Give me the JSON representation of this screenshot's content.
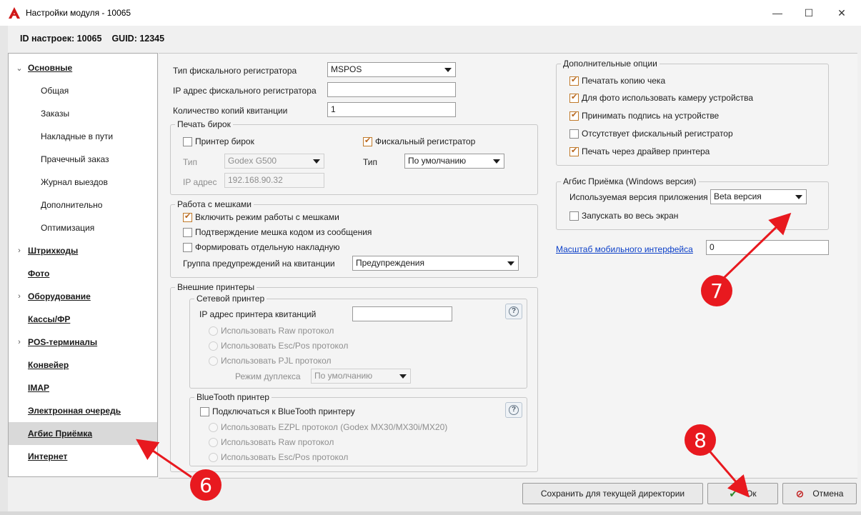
{
  "window": {
    "title": "Настройки модуля - 10065",
    "minimize": "—",
    "maximize": "☐",
    "close": "✕"
  },
  "ids": {
    "settings_id": "ID настроек: 10065",
    "guid": "GUID: 12345"
  },
  "nav": {
    "items": [
      {
        "label": "Основные",
        "caret": "⌄",
        "level": 1
      },
      {
        "label": "Общая",
        "level": 2
      },
      {
        "label": "Заказы",
        "level": 2
      },
      {
        "label": "Накладные в пути",
        "level": 2
      },
      {
        "label": "Прачечный заказ",
        "level": 2
      },
      {
        "label": "Журнал выездов",
        "level": 2
      },
      {
        "label": "Дополнительно",
        "level": 2
      },
      {
        "label": "Оптимизация",
        "level": 2
      },
      {
        "label": "Штрихкоды",
        "caret": "›",
        "level": 1
      },
      {
        "label": "Фото",
        "level": 1
      },
      {
        "label": "Оборудование",
        "caret": "›",
        "level": 1
      },
      {
        "label": "Кассы/ФР",
        "level": 1
      },
      {
        "label": "POS-терминалы",
        "caret": "›",
        "level": 1
      },
      {
        "label": "Конвейер",
        "level": 1
      },
      {
        "label": "IMAP",
        "level": 1
      },
      {
        "label": "Электронная очередь",
        "level": 1
      },
      {
        "label": "Агбис Приёмка",
        "level": 1,
        "selected": true
      },
      {
        "label": "Интернет",
        "level": 1
      }
    ]
  },
  "fiscal": {
    "type_label": "Тип фискального регистратора",
    "type_value": "MSPOS",
    "ip_label": "IP адрес фискального регистратора",
    "ip_value": "",
    "copies_label": "Количество копий квитанции",
    "copies_value": "1"
  },
  "tags_print": {
    "title": "Печать бирок",
    "tag_printer_label": "Принтер бирок",
    "tag_printer_checked": false,
    "fiscal_label": "Фискальный регистратор",
    "fiscal_checked": true,
    "type_label_left": "Тип",
    "type_value_left": "Godex G500",
    "ip_label": "IP адрес",
    "ip_value": "192.168.90.32",
    "type_label_right": "Тип",
    "type_value_right": "По умолчанию"
  },
  "bags": {
    "title": "Работа с мешками",
    "enable_label": "Включить режим работы с мешками",
    "enable_checked": true,
    "confirm_label": "Подтверждение мешка кодом из сообщения",
    "confirm_checked": false,
    "separate_label": "Формировать отдельную накладную",
    "separate_checked": false,
    "warn_group_label": "Группа предупреждений на квитанции",
    "warn_group_value": "Предупреждения"
  },
  "printers": {
    "title": "Внешние принтеры",
    "network": {
      "title": "Сетевой принтер",
      "ip_label": "IP адрес принтера квитанций",
      "ip_value": "",
      "raw": "Использовать Raw протокол",
      "escpos": "Использовать Esc/Pos протокол",
      "pjl": "Использовать PJL протокол",
      "duplex_label": "Режим дуплекса",
      "duplex_value": "По умолчанию",
      "help": "?"
    },
    "bluetooth": {
      "title": "BlueTooth принтер",
      "connect_label": "Подключаться к BlueTooth принтеру",
      "connect_checked": false,
      "ezpl": "Использовать EZPL протокол (Godex MX30/MX30i/MX20)",
      "raw": "Использовать Raw протокол",
      "escpos": "Использовать Esc/Pos протокол",
      "help": "?"
    }
  },
  "extra": {
    "title": "Дополнительные опции",
    "options": [
      {
        "label": "Печатать копию чека",
        "checked": true
      },
      {
        "label": "Для фото использовать камеру устройства",
        "checked": true
      },
      {
        "label": "Принимать подпись на устройстве",
        "checked": true
      },
      {
        "label": "Отсутствует фискальный регистратор",
        "checked": false
      },
      {
        "label": "Печать через драйвер принтера",
        "checked": true
      }
    ]
  },
  "agbis": {
    "title": "Агбис Приёмка (Windows версия)",
    "version_label": "Используемая версия приложения",
    "version_value": "Beta версия",
    "fullscreen_label": "Запускать во весь экран",
    "fullscreen_checked": false
  },
  "scale": {
    "link": "Масштаб мобильного интерфейса",
    "value": "0"
  },
  "buttons": {
    "save_dir": "Сохранить для текущей директории",
    "ok": "Ок",
    "cancel": "Отмена"
  },
  "annotations": {
    "six": "6",
    "seven": "7",
    "eight": "8"
  },
  "colors": {
    "accent_check": "#b7651c",
    "annotation_red": "#e8191f",
    "link": "#0b3fc8"
  }
}
